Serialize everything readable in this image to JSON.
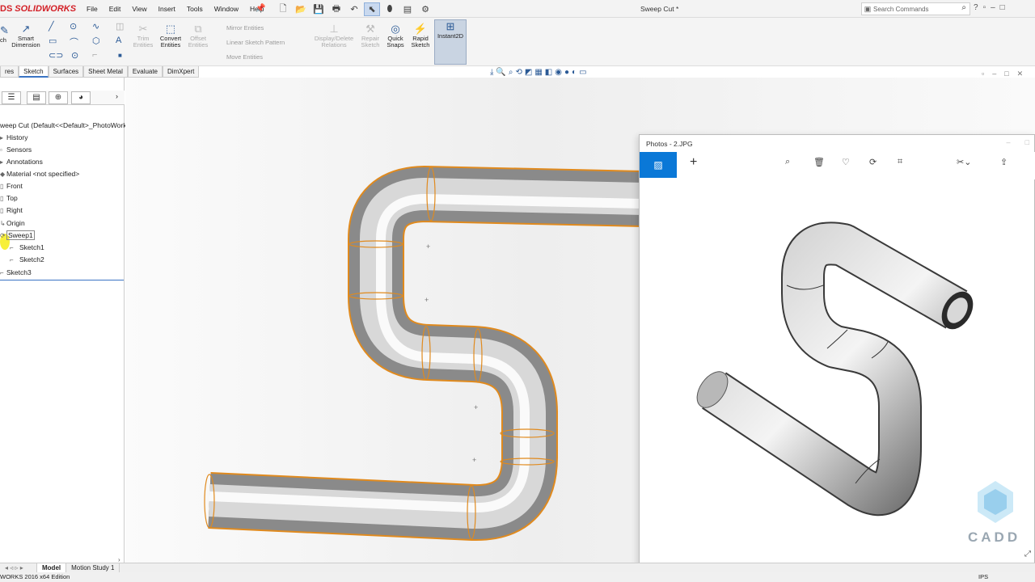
{
  "app": {
    "brand": "SOLIDWORKS",
    "brand_prefix": "DS",
    "doc_title": "Sweep Cut *"
  },
  "menu": [
    "File",
    "Edit",
    "View",
    "Insert",
    "Tools",
    "Window",
    "Help"
  ],
  "search": {
    "placeholder": "Search Commands"
  },
  "ribbon": {
    "sketch_partial": "ch",
    "smart_dimension": "Smart Dimension",
    "trim": "Trim Entities",
    "convert": "Convert Entities",
    "offset": "Offset Entities",
    "mirror": "Mirror Entities",
    "linear_pattern": "Linear Sketch Pattern",
    "move": "Move Entities",
    "display_delete": "Display/Delete Relations",
    "repair": "Repair Sketch",
    "quick_snaps": "Quick Snaps",
    "rapid_sketch": "Rapid Sketch",
    "instant2d": "Instant2D"
  },
  "tabs": [
    "res",
    "Sketch",
    "Surfaces",
    "Sheet Metal",
    "Evaluate",
    "DimXpert"
  ],
  "tree": {
    "root": "weep Cut  (Default<<Default>_PhotoWork",
    "items": [
      "History",
      "Sensors",
      "Annotations",
      "Material <not specified>",
      "Front",
      "Top",
      "Right",
      "Origin",
      "Sweep1",
      "Sketch1",
      "Sketch2",
      "Sketch3"
    ]
  },
  "bottom_tabs": [
    "Model",
    "Motion Study 1"
  ],
  "status": {
    "left": "WORKS 2016 x64 Edition",
    "right": "IPS"
  },
  "photos": {
    "title": "Photos - 2.JPG",
    "watermark": "CADD"
  },
  "colors": {
    "accent": "#0a78d7",
    "brand": "#d32027",
    "edge": "#e08a1e"
  }
}
